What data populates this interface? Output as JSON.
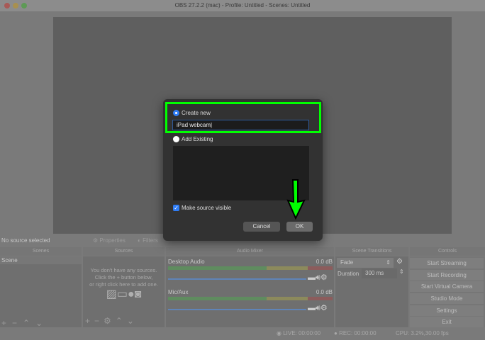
{
  "window": {
    "title": "OBS 27.2.2 (mac) - Profile: Untitled - Scenes: Untitled"
  },
  "source_bar": {
    "status": "No source selected",
    "properties": "Properties",
    "filters": "Filters"
  },
  "docks": {
    "scenes": "Scenes",
    "sources": "Sources",
    "mixer": "Audio Mixer",
    "transitions": "Scene Transitions",
    "controls": "Controls"
  },
  "scenes": {
    "items": [
      "Scene"
    ]
  },
  "sources": {
    "empty_line1": "You don't have any sources.",
    "empty_line2": "Click the + button below,",
    "empty_line3": "or right click here to add one."
  },
  "mixer": {
    "channels": [
      {
        "name": "Desktop Audio",
        "level": "0.0 dB"
      },
      {
        "name": "Mic/Aux",
        "level": "0.0 dB"
      }
    ]
  },
  "transitions": {
    "type": "Fade",
    "duration_label": "Duration",
    "duration": "300 ms"
  },
  "controls": [
    "Start Streaming",
    "Start Recording",
    "Start Virtual Camera",
    "Studio Mode",
    "Settings",
    "Exit"
  ],
  "status": {
    "live": "LIVE: 00:00:00",
    "rec": "REC: 00:00:00",
    "cpu": "CPU: 3.2%,30.00 fps"
  },
  "dialog": {
    "create_new": "Create new",
    "name_value": "iPad webcam",
    "add_existing": "Add Existing",
    "make_visible": "Make source visible",
    "make_visible_checked": true,
    "cancel": "Cancel",
    "ok": "OK"
  },
  "colors": {
    "highlight": "#00ff00",
    "accent": "#2f7df6"
  }
}
